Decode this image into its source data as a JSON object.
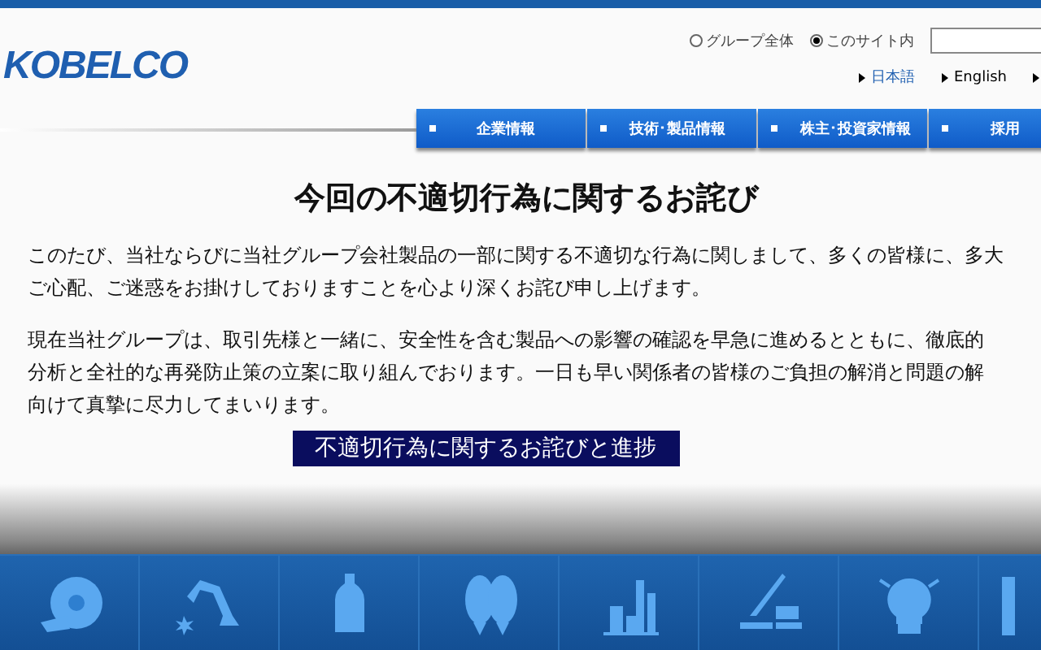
{
  "header": {
    "logo": "KOBELCO",
    "search_scope": [
      {
        "label": "グループ全体",
        "selected": false
      },
      {
        "label": "このサイト内",
        "selected": true
      }
    ],
    "languages": [
      {
        "label": "日本語",
        "selected": true
      },
      {
        "label": "English",
        "selected": false
      }
    ]
  },
  "nav_tabs": [
    {
      "label": "企業情報"
    },
    {
      "label": "技術･製品情報"
    },
    {
      "label": "株主･投資家情報"
    },
    {
      "label": "採用"
    }
  ],
  "notice": {
    "title": "今回の不適切行為に関するお詫び",
    "paragraphs": [
      [
        "このたび、当社ならびに当社グループ会社製品の一部に関する不適切な行為に関しまして、多くの皆様に、多大",
        "ご心配、ご迷惑をお掛けしておりますことを心より深くお詫び申し上げます。"
      ],
      [
        "現在当社グループは、取引先様と一緒に、安全性を含む製品への影響の確認を早急に進めるとともに、徹底的",
        "分析と全社的な再発防止策の立案に取り組んでおります。一日も早い関係者の皆様のご負担の解消と問題の解",
        "向けて真摯に尽力してまいります。"
      ]
    ],
    "link_button": "不適切行為に関するお詫びと進捗"
  },
  "category_tiles": [
    {
      "kind": "coil"
    },
    {
      "kind": "robot"
    },
    {
      "kind": "bottle"
    },
    {
      "kind": "rotor"
    },
    {
      "kind": "plant"
    },
    {
      "kind": "crane"
    },
    {
      "kind": "bulb"
    },
    {
      "kind": "building"
    }
  ]
}
